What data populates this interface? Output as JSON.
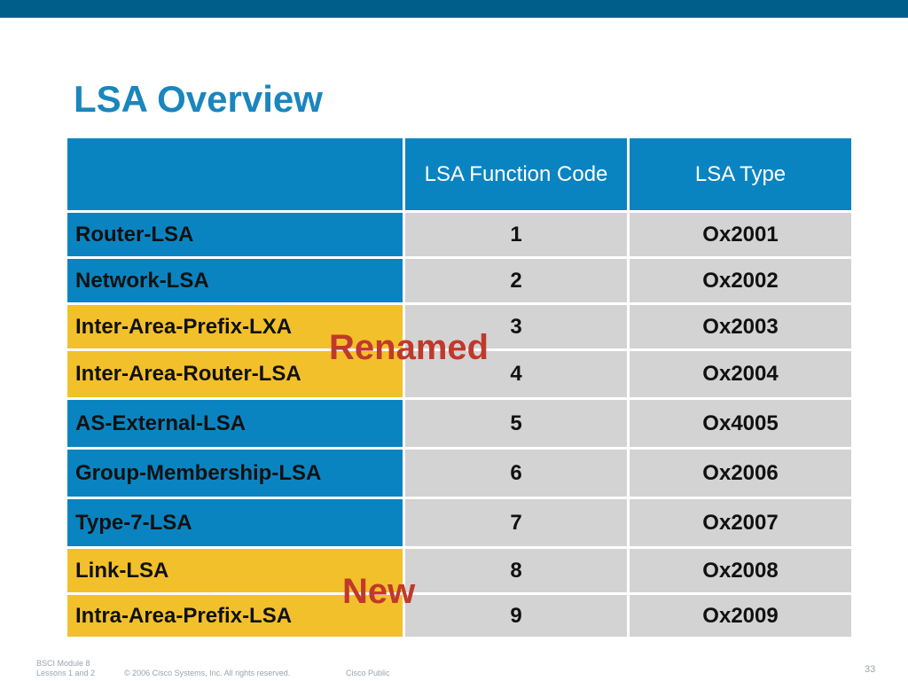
{
  "title": "LSA Overview",
  "colors": {
    "top_bar": "#005e8a",
    "title": "#1a86bd",
    "header_bg": "#0a84c0",
    "name_blue": "#0a84c0",
    "name_yellow": "#f2c02a",
    "value_bg": "#d3d3d3",
    "annotation": "#c0392b"
  },
  "table": {
    "headers": [
      "",
      "LSA Function Code",
      "LSA Type"
    ],
    "rows": [
      {
        "name": "Router-LSA",
        "code": "1",
        "type": "Ox2001",
        "highlight": "blue"
      },
      {
        "name": "Network-LSA",
        "code": "2",
        "type": "Ox2002",
        "highlight": "blue"
      },
      {
        "name": "Inter-Area-Prefix-LXA",
        "code": "3",
        "type": "Ox2003",
        "highlight": "yellow"
      },
      {
        "name": "Inter-Area-Router-LSA",
        "code": "4",
        "type": "Ox2004",
        "highlight": "yellow"
      },
      {
        "name": "AS-External-LSA",
        "code": "5",
        "type": "Ox4005",
        "highlight": "blue"
      },
      {
        "name": "Group-Membership-LSA",
        "code": "6",
        "type": "Ox2006",
        "highlight": "blue"
      },
      {
        "name": "Type-7-LSA",
        "code": "7",
        "type": "Ox2007",
        "highlight": "blue"
      },
      {
        "name": "Link-LSA",
        "code": "8",
        "type": "Ox2008",
        "highlight": "yellow"
      },
      {
        "name": "Intra-Area-Prefix-LSA",
        "code": "9",
        "type": "Ox2009",
        "highlight": "yellow"
      }
    ]
  },
  "annotations": {
    "renamed": "Renamed",
    "new": "New"
  },
  "footer": {
    "module_line1": "BSCI Module 8",
    "module_line2": "Lessons 1 and 2",
    "copyright": "© 2006 Cisco Systems, Inc. All rights reserved.",
    "classification": "Cisco Public",
    "page_number": "33"
  }
}
